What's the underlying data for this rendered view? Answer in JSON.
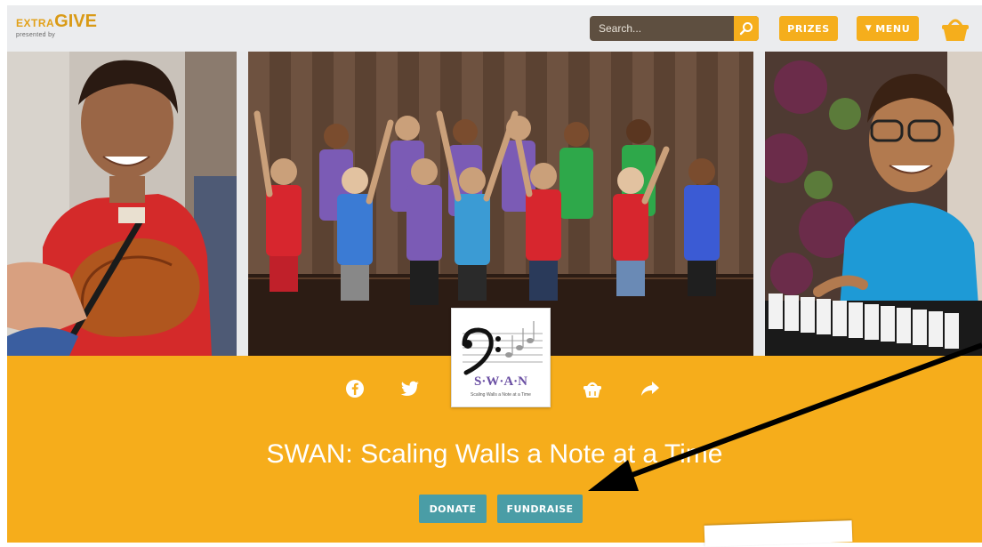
{
  "header": {
    "logo_extra": "EXTRA",
    "logo_give": "GIVE",
    "logo_sub": "presented by",
    "search_placeholder": "Search...",
    "prizes_label": "PRIZES",
    "menu_label": "MENU",
    "menu_arrow": "▼"
  },
  "campaign": {
    "title": "SWAN: Scaling Walls a Note at a Time",
    "badge_text": "S·W·A·N",
    "badge_caption": "Scaling Walls a Note at a Time",
    "donate_label": "DONATE",
    "fundraise_label": "FUNDRAISE"
  },
  "social_icons": [
    "facebook-icon",
    "twitter-icon",
    "basket-icon",
    "share-icon"
  ],
  "colors": {
    "accent": "#f6ad1b",
    "teal": "#4a9da6",
    "search_bg": "#5e4f40",
    "header_bg": "#ebecee"
  }
}
